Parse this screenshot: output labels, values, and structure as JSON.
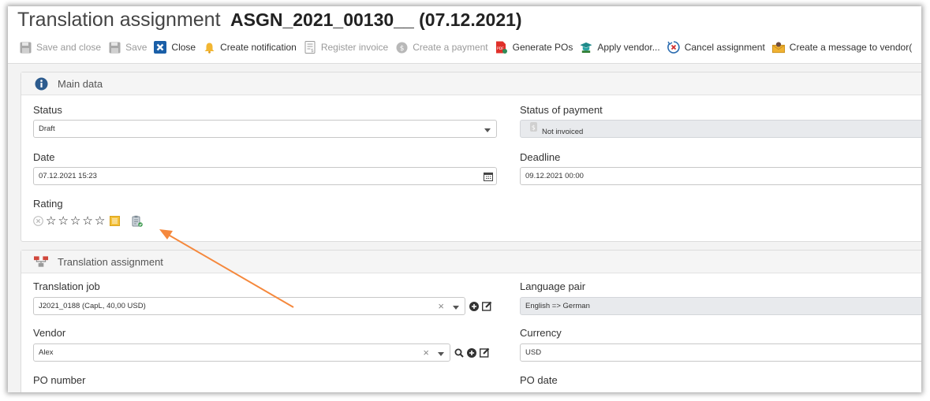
{
  "title": {
    "label": "Translation assignment",
    "code": "ASGN_2021_00130__ (07.12.2021)"
  },
  "toolbar": {
    "save_close": "Save and close",
    "save": "Save",
    "close": "Close",
    "create_notification": "Create notification",
    "register_invoice": "Register invoice",
    "create_payment": "Create a payment",
    "generate_pos": "Generate POs",
    "apply_vendor": "Apply vendor...",
    "cancel_assignment": "Cancel assignment",
    "create_message": "Create a message to vendor("
  },
  "main_data": {
    "heading": "Main data",
    "status": {
      "label": "Status",
      "value": "Draft"
    },
    "status_payment": {
      "label": "Status of payment",
      "value": "Not invoiced"
    },
    "date": {
      "label": "Date",
      "value": "07.12.2021 15:23"
    },
    "deadline": {
      "label": "Deadline",
      "value": "09.12.2021 00:00"
    },
    "rating": {
      "label": "Rating",
      "stars": 5,
      "filled": 0
    }
  },
  "assignment": {
    "heading": "Translation assignment",
    "translation_job": {
      "label": "Translation job",
      "value": "J2021_0188 (CapL, 40,00 USD)"
    },
    "language_pair": {
      "label": "Language pair",
      "value": "English => German"
    },
    "vendor": {
      "label": "Vendor",
      "value": "Alex"
    },
    "currency": {
      "label": "Currency",
      "value": "USD"
    },
    "po_number": {
      "label": "PO number"
    },
    "po_date": {
      "label": "PO date"
    }
  },
  "colors": {
    "arrow": "#f5883c",
    "info": "#2c5b8e",
    "close_icon": "#1a5fa8"
  }
}
